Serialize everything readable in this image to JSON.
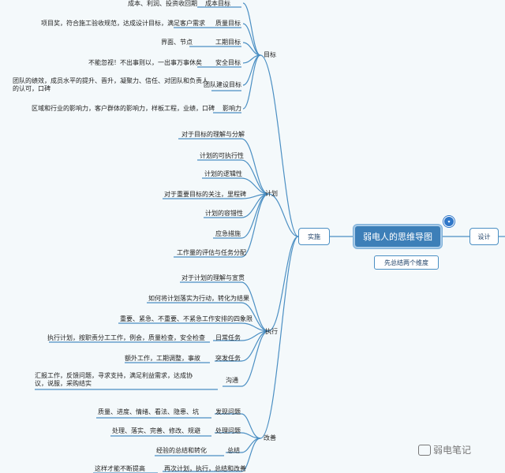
{
  "central": {
    "title": "弱电人的思维导图",
    "subtitle": "先总结两个维度",
    "badge": "▾"
  },
  "branches": {
    "left": "实施",
    "right": "设计"
  },
  "sections": {
    "goals": "目标",
    "plan": "计划",
    "exec": "执行",
    "improve": "改善"
  },
  "goals": [
    {
      "desc": "成本、利润、投资收回期",
      "name": "成本目标"
    },
    {
      "desc": "项目奖，符合施工验收规范，达成设计目标，满足客户需求",
      "name": "质量目标"
    },
    {
      "desc": "界面、节点",
      "name": "工期目标"
    },
    {
      "desc": "不能忽视！不出事则以，一出事万事休矣",
      "name": "安全目标"
    },
    {
      "desc": "团队的绩效，成员水平的提升、晋升，凝聚力、信任、对团队和负责人的认可，口碑",
      "name": "团队建设目标"
    },
    {
      "desc": "区域和行业的影响力，客户群体的影响力，样板工程，业绩，口碑",
      "name": "影响力"
    }
  ],
  "plan": [
    "对于目标的理解与分解",
    "计划的可执行性",
    "计划的逻辑性",
    "对于重要目标的关注，里程碑",
    "计划的容错性",
    "应急措施",
    "工作量的评估与任务分配"
  ],
  "exec": {
    "top": [
      "对于计划的理解与宣贯",
      "如何将计划落实为行动，转化为结果",
      "重要、紧急、不重要、不紧急工作安排的四象限"
    ],
    "tasks": [
      {
        "desc": "执行计划，按职责分工工作，例会，质量检查，安全检查",
        "name": "日常任务"
      },
      {
        "desc": "额外工作，工期调整，事故",
        "name": "突发任务"
      },
      {
        "desc": "汇报工作，反馈问题，寻求支持，满足利益需求，达成协议，说服，采购结实",
        "name": "沟通"
      }
    ]
  },
  "improve": [
    {
      "desc": "质量、进度、情绪、看法、隐患、坑",
      "name": "发现问题"
    },
    {
      "desc": "处理、落实、完善、修改、规避",
      "name": "处理问题"
    },
    {
      "desc": "经验的总结和转化",
      "name": "总结"
    },
    {
      "desc": "这样才能不断提高",
      "name": "再次计划，执行，总结和改善"
    }
  ],
  "watermark": "弱电笔记",
  "colors": {
    "accent": "#3d7fb8",
    "line": "#4b8fc3",
    "bg": "#f4f9fb"
  }
}
